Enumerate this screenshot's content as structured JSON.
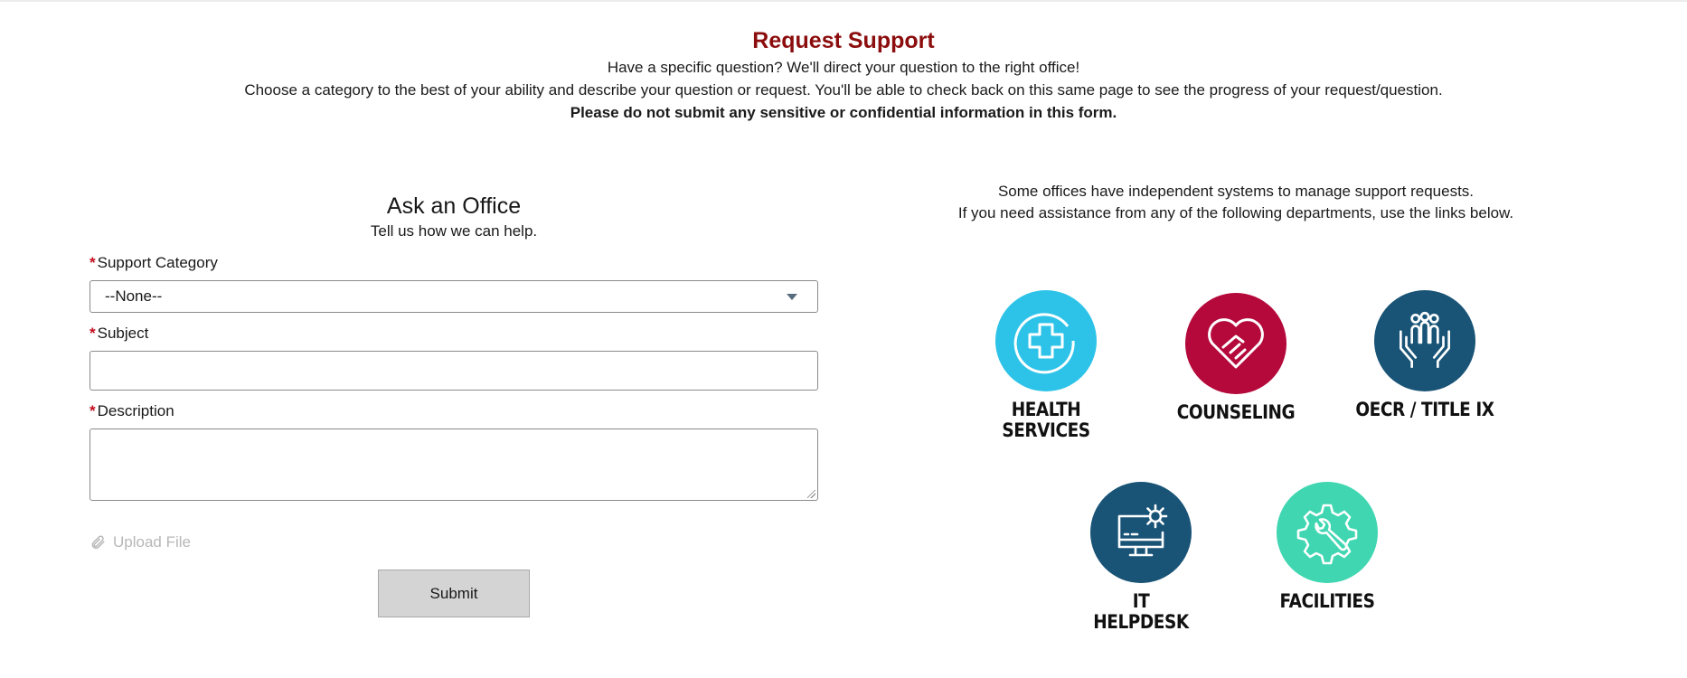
{
  "header": {
    "title": "Request Support",
    "line1": "Have a specific question? We'll direct your question to the right office!",
    "line2": "Choose a category to the best of your ability and describe your question or request. You'll be able to check back on this same page to see the progress of your request/question.",
    "warning": "Please do not submit any sensitive or confidential information in this form."
  },
  "form": {
    "title": "Ask an Office",
    "subtitle": "Tell us how we can help.",
    "required_mark": "*",
    "category_label": "Support Category",
    "category_value": "--None--",
    "subject_label": "Subject",
    "description_label": "Description",
    "upload_label": "Upload File",
    "submit_label": "Submit"
  },
  "departments": {
    "intro_line1": "Some offices have independent systems to manage support requests.",
    "intro_line2": "If you need assistance from any of the following departments, use the links below.",
    "items": [
      {
        "line1": "HEALTH",
        "line2": "SERVICES",
        "icon": "health-cross-icon",
        "color": "#2dc3e8"
      },
      {
        "line1": "COUNSELING",
        "line2": "",
        "icon": "heart-handshake-icon",
        "color": "#b5093c"
      },
      {
        "line1": "OECR / TITLE IX",
        "line2": "",
        "icon": "hands-people-icon",
        "color": "#195477"
      },
      {
        "line1": "IT",
        "line2": "HELPDESK",
        "icon": "monitor-gear-icon",
        "color": "#195477"
      },
      {
        "line1": "FACILITIES",
        "line2": "",
        "icon": "gear-wrench-icon",
        "color": "#3fd6b1"
      }
    ]
  },
  "colors": {
    "title_red": "#8c0d0d",
    "required_red": "#c40d1e",
    "submit_bg": "#d4d4d4"
  }
}
